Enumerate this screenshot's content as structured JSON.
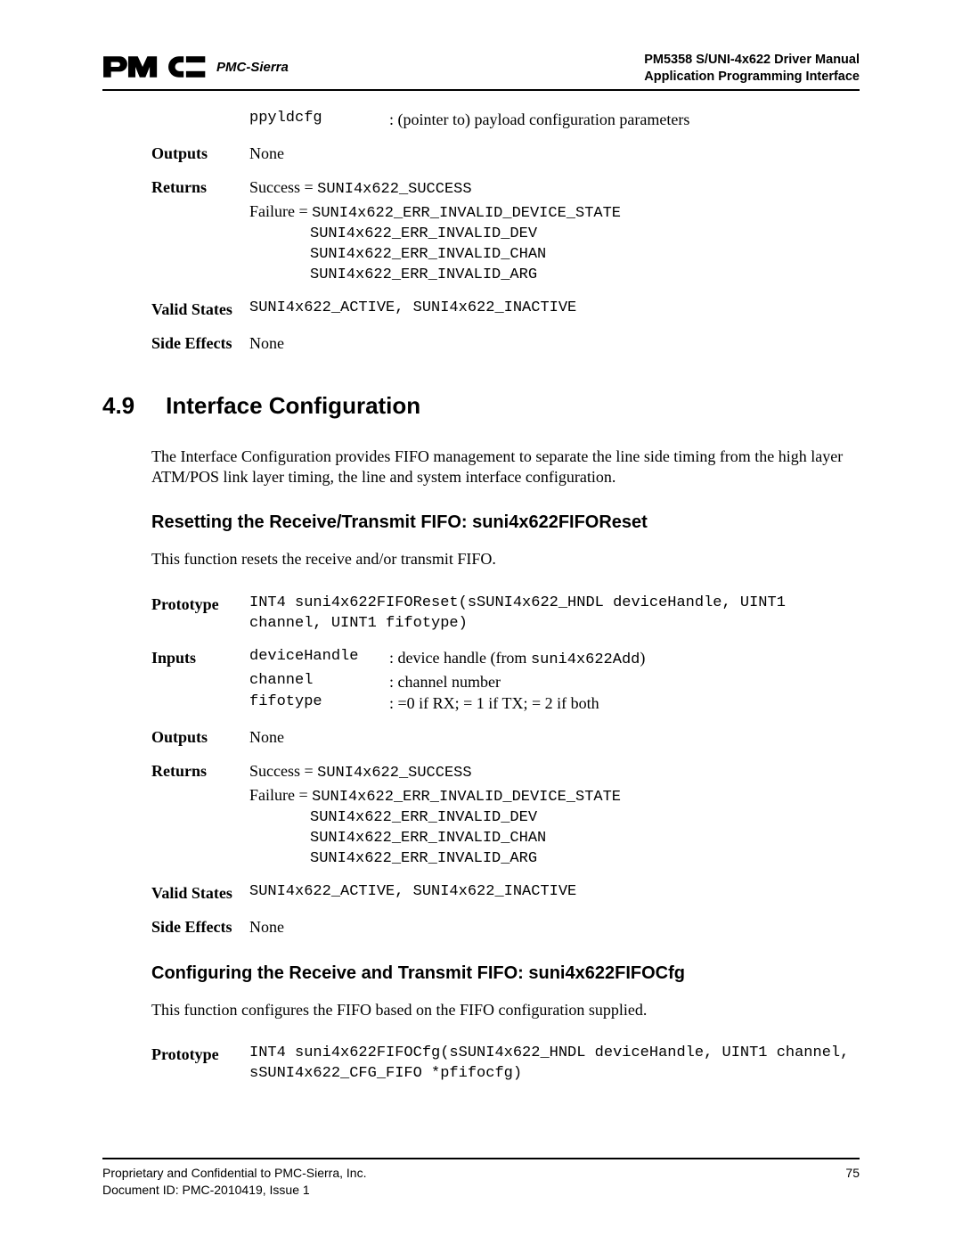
{
  "header": {
    "brand": "PMC-Sierra",
    "title_line1": "PM5358 S/UNI-4x622 Driver Manual",
    "title_line2": "Application Programming Interface"
  },
  "topblock": {
    "param_name": "ppyldcfg",
    "param_desc": ": (pointer to) payload configuration parameters",
    "outputs_label": "Outputs",
    "outputs_value": "None",
    "returns_label": "Returns",
    "success_prefix": "Success = ",
    "success_code": "SUNI4x622_SUCCESS",
    "failure_prefix": "Failure = ",
    "failure_codes": [
      "SUNI4x622_ERR_INVALID_DEVICE_STATE",
      "SUNI4x622_ERR_INVALID_DEV",
      "SUNI4x622_ERR_INVALID_CHAN",
      "SUNI4x622_ERR_INVALID_ARG"
    ],
    "valid_states_label": "Valid States",
    "valid_states_value": "SUNI4x622_ACTIVE, SUNI4x622_INACTIVE",
    "side_effects_label": "Side Effects",
    "side_effects_value": "None"
  },
  "section": {
    "num": "4.9",
    "title": "Interface Configuration",
    "intro": "The Interface Configuration provides FIFO management to separate the line side timing from the high layer ATM/POS link layer timing, the line and system interface configuration."
  },
  "fiforeset": {
    "heading": "Resetting the Receive/Transmit FIFO: suni4x622FIFOReset",
    "desc": "This function resets the receive and/or transmit FIFO.",
    "prototype_label": "Prototype",
    "prototype_code": "INT4 suni4x622FIFOReset(sSUNI4x622_HNDL deviceHandle, UINT1 channel, UINT1 fifotype)",
    "inputs_label": "Inputs",
    "inputs": [
      {
        "name": "deviceHandle",
        "desc_pre": ": device handle (from ",
        "desc_mono": "suni4x622Add",
        "desc_post": ")"
      },
      {
        "name": "channel",
        "desc_pre": ": channel number",
        "desc_mono": "",
        "desc_post": ""
      },
      {
        "name": "fifotype",
        "desc_pre": ": =0 if RX; = 1 if TX; = 2 if both",
        "desc_mono": "",
        "desc_post": ""
      }
    ],
    "outputs_label": "Outputs",
    "outputs_value": "None",
    "returns_label": "Returns",
    "success_prefix": "Success = ",
    "success_code": "SUNI4x622_SUCCESS",
    "failure_prefix": "Failure = ",
    "failure_codes": [
      "SUNI4x622_ERR_INVALID_DEVICE_STATE",
      "SUNI4x622_ERR_INVALID_DEV",
      "SUNI4x622_ERR_INVALID_CHAN",
      "SUNI4x622_ERR_INVALID_ARG"
    ],
    "valid_states_label": "Valid States",
    "valid_states_value": "SUNI4x622_ACTIVE, SUNI4x622_INACTIVE",
    "side_effects_label": "Side Effects",
    "side_effects_value": "None"
  },
  "fifocfg": {
    "heading": "Configuring the Receive and Transmit FIFO: suni4x622FIFOCfg",
    "desc": "This function configures the FIFO based on the FIFO configuration supplied.",
    "prototype_label": "Prototype",
    "prototype_code": "INT4 suni4x622FIFOCfg(sSUNI4x622_HNDL deviceHandle, UINT1 channel, sSUNI4x622_CFG_FIFO *pfifocfg)"
  },
  "footer": {
    "left_line1": "Proprietary and Confidential to PMC-Sierra, Inc.",
    "left_line2": "Document ID: PMC-2010419, Issue 1",
    "page": "75"
  }
}
